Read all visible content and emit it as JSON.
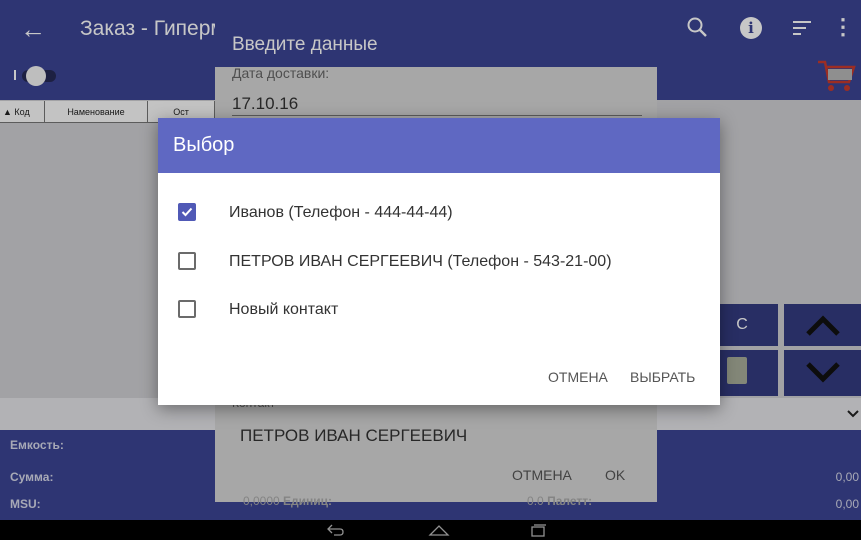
{
  "app": {
    "title": "Заказ - Гипермаркет",
    "table_headers": [
      "Код",
      "Наменование",
      "Ост"
    ],
    "key_c_label": "C",
    "bottom": {
      "capacity_label": "Емкость:",
      "sum_label": "Сумма:",
      "sum_value": "0,00",
      "msu_label": "MSU:",
      "msu_value": "0,00"
    }
  },
  "data_dialog": {
    "title": "Введите данные",
    "delivery_date_label": "Дата доставки:",
    "delivery_date_value": "17.10.16",
    "contact_label": "Контакт",
    "contact_value": "ПЕТРОВ ИВАН СЕРГЕЕВИЧ",
    "cancel_label": "ОТМЕНА",
    "ok_label": "OK",
    "footer_left_value": "0,0000",
    "footer_left_label": "Единиц:",
    "footer_right_value": "0.0",
    "footer_right_label": "Палетт:"
  },
  "choice_dialog": {
    "title": "Выбор",
    "options": [
      {
        "label": "Иванов  (Телефон - 444-44-44)",
        "checked": true
      },
      {
        "label": " ПЕТРОВ ИВАН СЕРГЕЕВИЧ  (Телефон - 543-21-00)",
        "checked": false
      },
      {
        "label": "Новый контакт",
        "checked": false
      }
    ],
    "cancel_label": "ОТМЕНА",
    "select_label": "ВЫБРАТЬ"
  },
  "colors": {
    "primary": "#3c4494",
    "dialog_header": "#5f68c2",
    "checkbox_accent": "#5059b6"
  }
}
